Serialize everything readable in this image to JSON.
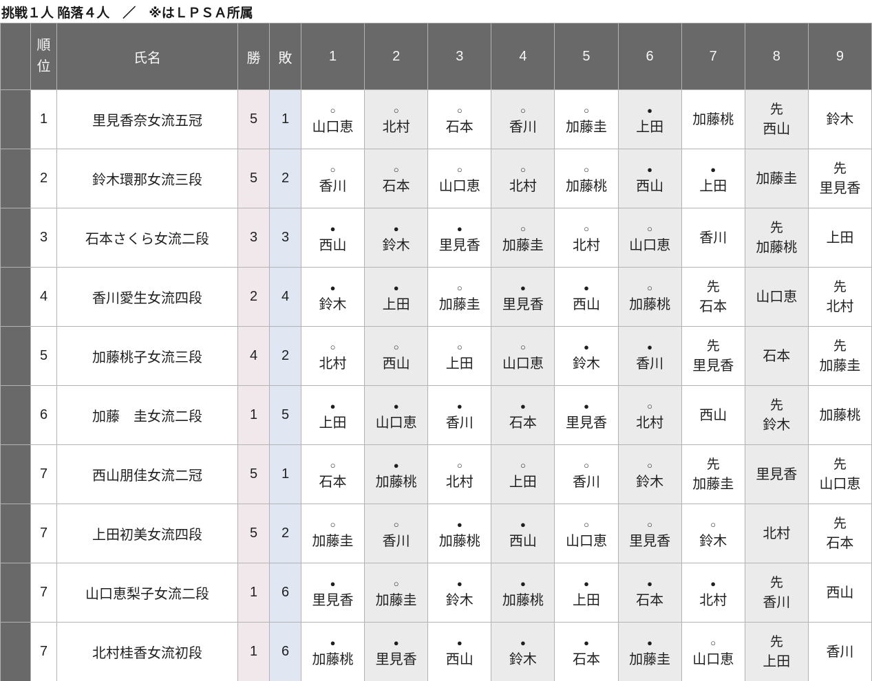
{
  "title": "挑戦１人 陥落４人　／　※はＬＰＳＡ所属",
  "legend": {
    "win_mark": "○",
    "loss_mark": "●",
    "sente_mark": "先"
  },
  "colors": {
    "header_bg": "#696969",
    "accent_col_bg": "#696969",
    "wins_col_bg": "#f1e8ec",
    "losses_col_bg": "#e0e6f2",
    "alt_round_col_bg": "#ebebeb",
    "cell_bg": "#ffffff",
    "border": "#b3b3b3",
    "header_text": "#f7f7f7",
    "body_text": "#1f1f1f"
  },
  "table": {
    "headers": {
      "rank": "順位",
      "name": "氏名",
      "wins": "勝",
      "losses": "敗",
      "rounds": [
        "1",
        "2",
        "3",
        "4",
        "5",
        "6",
        "7",
        "8",
        "9"
      ]
    },
    "rows": [
      {
        "rank": "1",
        "name": "里見香奈女流五冠",
        "wins": "5",
        "losses": "1",
        "rounds": [
          {
            "mark": "win",
            "opp": "山口恵"
          },
          {
            "mark": "win",
            "opp": "北村"
          },
          {
            "mark": "win",
            "opp": "石本"
          },
          {
            "mark": "win",
            "opp": "香川"
          },
          {
            "mark": "win",
            "opp": "加藤圭"
          },
          {
            "mark": "loss",
            "opp": "上田"
          },
          {
            "mark": "none",
            "opp": "加藤桃"
          },
          {
            "mark": "sente",
            "opp": "西山"
          },
          {
            "mark": "none",
            "opp": "鈴木"
          }
        ]
      },
      {
        "rank": "2",
        "name": "鈴木環那女流三段",
        "wins": "5",
        "losses": "2",
        "rounds": [
          {
            "mark": "win",
            "opp": "香川"
          },
          {
            "mark": "win",
            "opp": "石本"
          },
          {
            "mark": "win",
            "opp": "山口恵"
          },
          {
            "mark": "win",
            "opp": "北村"
          },
          {
            "mark": "win",
            "opp": "加藤桃"
          },
          {
            "mark": "loss",
            "opp": "西山"
          },
          {
            "mark": "loss",
            "opp": "上田"
          },
          {
            "mark": "none",
            "opp": "加藤圭"
          },
          {
            "mark": "sente",
            "opp": "里見香"
          }
        ]
      },
      {
        "rank": "3",
        "name": "石本さくら女流二段",
        "wins": "3",
        "losses": "3",
        "rounds": [
          {
            "mark": "loss",
            "opp": "西山"
          },
          {
            "mark": "loss",
            "opp": "鈴木"
          },
          {
            "mark": "loss",
            "opp": "里見香"
          },
          {
            "mark": "win",
            "opp": "加藤圭"
          },
          {
            "mark": "win",
            "opp": "北村"
          },
          {
            "mark": "win",
            "opp": "山口恵"
          },
          {
            "mark": "none",
            "opp": "香川"
          },
          {
            "mark": "sente",
            "opp": "加藤桃"
          },
          {
            "mark": "none",
            "opp": "上田"
          }
        ]
      },
      {
        "rank": "4",
        "name": "香川愛生女流四段",
        "wins": "2",
        "losses": "4",
        "rounds": [
          {
            "mark": "loss",
            "opp": "鈴木"
          },
          {
            "mark": "loss",
            "opp": "上田"
          },
          {
            "mark": "win",
            "opp": "加藤圭"
          },
          {
            "mark": "loss",
            "opp": "里見香"
          },
          {
            "mark": "loss",
            "opp": "西山"
          },
          {
            "mark": "win",
            "opp": "加藤桃"
          },
          {
            "mark": "sente",
            "opp": "石本"
          },
          {
            "mark": "none",
            "opp": "山口恵"
          },
          {
            "mark": "sente",
            "opp": "北村"
          }
        ]
      },
      {
        "rank": "5",
        "name": "加藤桃子女流三段",
        "wins": "4",
        "losses": "2",
        "rounds": [
          {
            "mark": "win",
            "opp": "北村"
          },
          {
            "mark": "win",
            "opp": "西山"
          },
          {
            "mark": "win",
            "opp": "上田"
          },
          {
            "mark": "win",
            "opp": "山口恵"
          },
          {
            "mark": "loss",
            "opp": "鈴木"
          },
          {
            "mark": "loss",
            "opp": "香川"
          },
          {
            "mark": "sente",
            "opp": "里見香"
          },
          {
            "mark": "none",
            "opp": "石本"
          },
          {
            "mark": "sente",
            "opp": "加藤圭"
          }
        ]
      },
      {
        "rank": "6",
        "name": "加藤　圭女流二段",
        "wins": "1",
        "losses": "5",
        "rounds": [
          {
            "mark": "loss",
            "opp": "上田"
          },
          {
            "mark": "loss",
            "opp": "山口恵"
          },
          {
            "mark": "loss",
            "opp": "香川"
          },
          {
            "mark": "loss",
            "opp": "石本"
          },
          {
            "mark": "loss",
            "opp": "里見香"
          },
          {
            "mark": "win",
            "opp": "北村"
          },
          {
            "mark": "none",
            "opp": "西山"
          },
          {
            "mark": "sente",
            "opp": "鈴木"
          },
          {
            "mark": "none",
            "opp": "加藤桃"
          }
        ]
      },
      {
        "rank": "7",
        "name": "西山朋佳女流二冠",
        "wins": "5",
        "losses": "1",
        "rounds": [
          {
            "mark": "win",
            "opp": "石本"
          },
          {
            "mark": "loss",
            "opp": "加藤桃"
          },
          {
            "mark": "win",
            "opp": "北村"
          },
          {
            "mark": "win",
            "opp": "上田"
          },
          {
            "mark": "win",
            "opp": "香川"
          },
          {
            "mark": "win",
            "opp": "鈴木"
          },
          {
            "mark": "sente",
            "opp": "加藤圭"
          },
          {
            "mark": "none",
            "opp": "里見香"
          },
          {
            "mark": "sente",
            "opp": "山口恵"
          }
        ]
      },
      {
        "rank": "7",
        "name": "上田初美女流四段",
        "wins": "5",
        "losses": "2",
        "rounds": [
          {
            "mark": "win",
            "opp": "加藤圭"
          },
          {
            "mark": "win",
            "opp": "香川"
          },
          {
            "mark": "loss",
            "opp": "加藤桃"
          },
          {
            "mark": "loss",
            "opp": "西山"
          },
          {
            "mark": "win",
            "opp": "山口恵"
          },
          {
            "mark": "win",
            "opp": "里見香"
          },
          {
            "mark": "win",
            "opp": "鈴木"
          },
          {
            "mark": "none",
            "opp": "北村"
          },
          {
            "mark": "sente",
            "opp": "石本"
          }
        ]
      },
      {
        "rank": "7",
        "name": "山口恵梨子女流二段",
        "wins": "1",
        "losses": "6",
        "rounds": [
          {
            "mark": "loss",
            "opp": "里見香"
          },
          {
            "mark": "win",
            "opp": "加藤圭"
          },
          {
            "mark": "loss",
            "opp": "鈴木"
          },
          {
            "mark": "loss",
            "opp": "加藤桃"
          },
          {
            "mark": "loss",
            "opp": "上田"
          },
          {
            "mark": "loss",
            "opp": "石本"
          },
          {
            "mark": "loss",
            "opp": "北村"
          },
          {
            "mark": "sente",
            "opp": "香川"
          },
          {
            "mark": "none",
            "opp": "西山"
          }
        ]
      },
      {
        "rank": "7",
        "name": "北村桂香女流初段",
        "wins": "1",
        "losses": "6",
        "rounds": [
          {
            "mark": "loss",
            "opp": "加藤桃"
          },
          {
            "mark": "loss",
            "opp": "里見香"
          },
          {
            "mark": "loss",
            "opp": "西山"
          },
          {
            "mark": "loss",
            "opp": "鈴木"
          },
          {
            "mark": "loss",
            "opp": "石本"
          },
          {
            "mark": "loss",
            "opp": "加藤圭"
          },
          {
            "mark": "win",
            "opp": "山口恵"
          },
          {
            "mark": "sente",
            "opp": "上田"
          },
          {
            "mark": "none",
            "opp": "香川"
          }
        ]
      }
    ]
  }
}
